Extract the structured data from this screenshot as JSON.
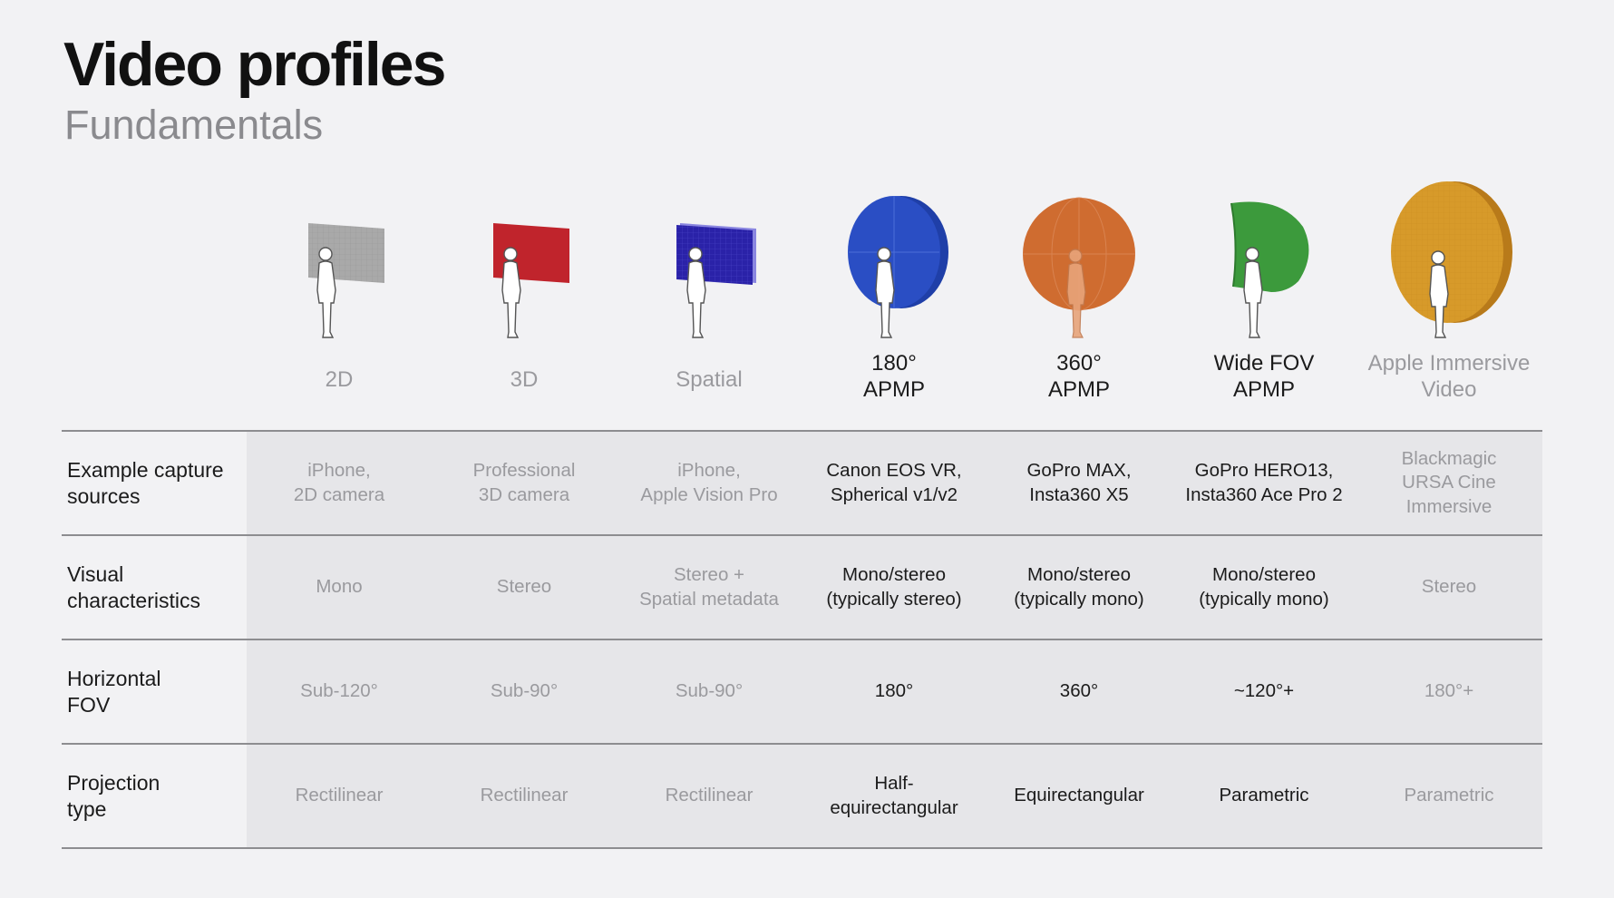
{
  "header": {
    "title": "Video profiles",
    "subtitle": "Fundamentals"
  },
  "columns": [
    {
      "label": "2D",
      "style": "dim",
      "icon": "flat-screen-gray-icon",
      "color": "#9e9e9e"
    },
    {
      "label": "3D",
      "style": "dim",
      "icon": "flat-screen-red-icon",
      "color": "#c0242c"
    },
    {
      "label": "Spatial",
      "style": "dim",
      "icon": "flat-screen-blue-grid-icon",
      "color": "#2a22a8"
    },
    {
      "label": "180°\nAPMP",
      "style": "dark",
      "icon": "half-sphere-blue-icon",
      "color": "#2a4ec4"
    },
    {
      "label": "360°\nAPMP",
      "style": "dark",
      "icon": "full-sphere-orange-icon",
      "color": "#cf6c30"
    },
    {
      "label": "Wide FOV\nAPMP",
      "style": "dark",
      "icon": "curved-screen-green-icon",
      "color": "#3c9a3c"
    },
    {
      "label": "Apple Immersive\nVideo",
      "style": "dim",
      "icon": "dome-gold-icon",
      "color": "#d79a2a"
    }
  ],
  "rows": [
    {
      "label": "Example capture\nsources",
      "cells": [
        "iPhone,\n2D camera",
        "Professional\n3D camera",
        "iPhone,\nApple Vision Pro",
        "Canon EOS VR,\nSpherical v1/v2",
        "GoPro MAX,\nInsta360 X5",
        "GoPro HERO13,\nInsta360 Ace Pro 2",
        "Blackmagic\nURSA Cine\nImmersive"
      ]
    },
    {
      "label": "Visual\ncharacteristics",
      "cells": [
        "Mono",
        "Stereo",
        "Stereo +\nSpatial metadata",
        "Mono/stereo\n(typically stereo)",
        "Mono/stereo\n(typically mono)",
        "Mono/stereo\n(typically mono)",
        "Stereo"
      ]
    },
    {
      "label": "Horizontal\nFOV",
      "cells": [
        "Sub-120°",
        "Sub-90°",
        "Sub-90°",
        "180°",
        "360°",
        "~120°+",
        "180°+"
      ]
    },
    {
      "label": "Projection\ntype",
      "cells": [
        "Rectilinear",
        "Rectilinear",
        "Rectilinear",
        "Half-\nequirectangular",
        "Equirectangular",
        "Parametric",
        "Parametric"
      ]
    }
  ]
}
